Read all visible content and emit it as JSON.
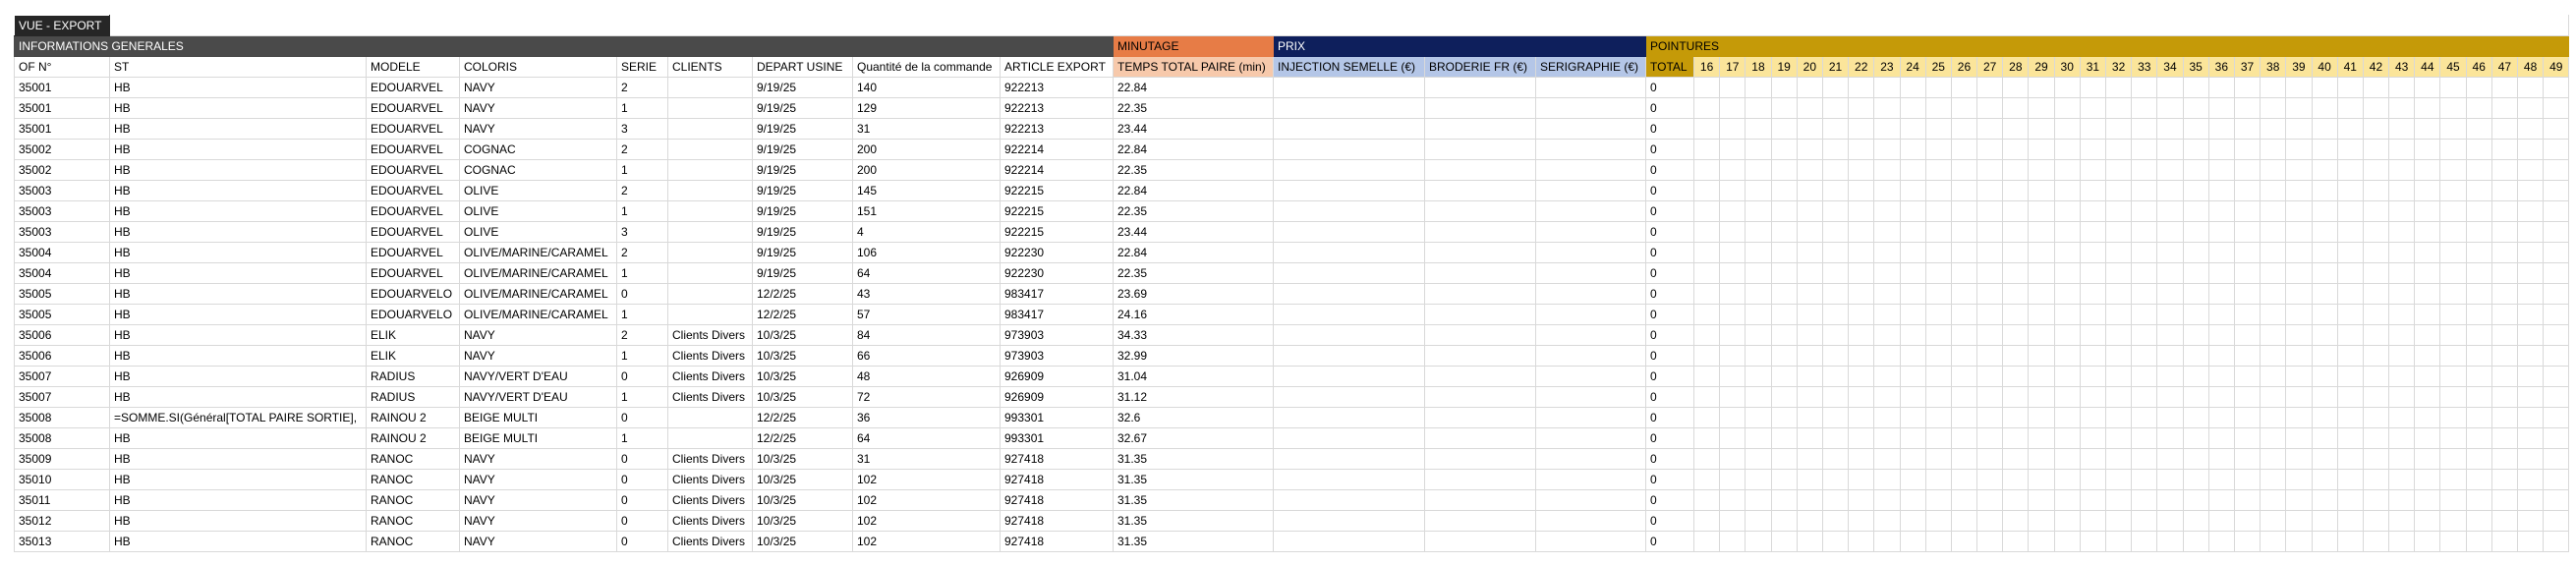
{
  "toolbar": {
    "view_label": "VUE - EXPORT"
  },
  "sections": {
    "info": "INFORMATIONS GENERALES",
    "minutage": "MINUTAGE",
    "prix": "PRIX",
    "pointures": "POINTURES"
  },
  "headers": {
    "of": "OF N°",
    "st": "ST",
    "modele": "MODELE",
    "coloris": "COLORIS",
    "serie": "SERIE",
    "clients": "CLIENTS",
    "depart": "DEPART USINE",
    "quantite": "Quantité de la commande",
    "article": "ARTICLE EXPORT",
    "temps": "TEMPS TOTAL PAIRE (min)",
    "injection": "INJECTION SEMELLE (€)",
    "broderie": "BRODERIE FR (€)",
    "serigraphie": "SERIGRAPHIE (€)",
    "total": "TOTAL"
  },
  "sizes": [
    "16",
    "17",
    "18",
    "19",
    "20",
    "21",
    "22",
    "23",
    "24",
    "25",
    "26",
    "27",
    "28",
    "29",
    "30",
    "31",
    "32",
    "33",
    "34",
    "35",
    "36",
    "37",
    "38",
    "39",
    "40",
    "41",
    "42",
    "43",
    "44",
    "45",
    "46",
    "47",
    "48",
    "49"
  ],
  "rows": [
    {
      "of": "35001",
      "st": "HB",
      "modele": "EDOUARVEL",
      "coloris": "NAVY",
      "serie": "2",
      "clients": "",
      "depart": "9/19/25",
      "quantite": "140",
      "article": "922213",
      "temps": "22.84",
      "total": "0"
    },
    {
      "of": "35001",
      "st": "HB",
      "modele": "EDOUARVEL",
      "coloris": "NAVY",
      "serie": "1",
      "clients": "",
      "depart": "9/19/25",
      "quantite": "129",
      "article": "922213",
      "temps": "22.35",
      "total": "0"
    },
    {
      "of": "35001",
      "st": "HB",
      "modele": "EDOUARVEL",
      "coloris": "NAVY",
      "serie": "3",
      "clients": "",
      "depart": "9/19/25",
      "quantite": "31",
      "article": "922213",
      "temps": "23.44",
      "total": "0"
    },
    {
      "of": "35002",
      "st": "HB",
      "modele": "EDOUARVEL",
      "coloris": "COGNAC",
      "serie": "2",
      "clients": "",
      "depart": "9/19/25",
      "quantite": "200",
      "article": "922214",
      "temps": "22.84",
      "total": "0"
    },
    {
      "of": "35002",
      "st": "HB",
      "modele": "EDOUARVEL",
      "coloris": "COGNAC",
      "serie": "1",
      "clients": "",
      "depart": "9/19/25",
      "quantite": "200",
      "article": "922214",
      "temps": "22.35",
      "total": "0"
    },
    {
      "of": "35003",
      "st": "HB",
      "modele": "EDOUARVEL",
      "coloris": "OLIVE",
      "serie": "2",
      "clients": "",
      "depart": "9/19/25",
      "quantite": "145",
      "article": "922215",
      "temps": "22.84",
      "total": "0"
    },
    {
      "of": "35003",
      "st": "HB",
      "modele": "EDOUARVEL",
      "coloris": "OLIVE",
      "serie": "1",
      "clients": "",
      "depart": "9/19/25",
      "quantite": "151",
      "article": "922215",
      "temps": "22.35",
      "total": "0"
    },
    {
      "of": "35003",
      "st": "HB",
      "modele": "EDOUARVEL",
      "coloris": "OLIVE",
      "serie": "3",
      "clients": "",
      "depart": "9/19/25",
      "quantite": "4",
      "article": "922215",
      "temps": "23.44",
      "total": "0"
    },
    {
      "of": "35004",
      "st": "HB",
      "modele": "EDOUARVEL",
      "coloris": "OLIVE/MARINE/CARAMEL",
      "serie": "2",
      "clients": "",
      "depart": "9/19/25",
      "quantite": "106",
      "article": "922230",
      "temps": "22.84",
      "total": "0"
    },
    {
      "of": "35004",
      "st": "HB",
      "modele": "EDOUARVEL",
      "coloris": "OLIVE/MARINE/CARAMEL",
      "serie": "1",
      "clients": "",
      "depart": "9/19/25",
      "quantite": "64",
      "article": "922230",
      "temps": "22.35",
      "total": "0"
    },
    {
      "of": "35005",
      "st": "HB",
      "modele": "EDOUARVELO",
      "coloris": "OLIVE/MARINE/CARAMEL",
      "serie": "0",
      "clients": "",
      "depart": "12/2/25",
      "quantite": "43",
      "article": "983417",
      "temps": "23.69",
      "total": "0"
    },
    {
      "of": "35005",
      "st": "HB",
      "modele": "EDOUARVELO",
      "coloris": "OLIVE/MARINE/CARAMEL",
      "serie": "1",
      "clients": "",
      "depart": "12/2/25",
      "quantite": "57",
      "article": "983417",
      "temps": "24.16",
      "total": "0"
    },
    {
      "of": "35006",
      "st": "HB",
      "modele": "ELIK",
      "coloris": "NAVY",
      "serie": "2",
      "clients": "Clients Divers",
      "depart": "10/3/25",
      "quantite": "84",
      "article": "973903",
      "temps": "34.33",
      "total": "0"
    },
    {
      "of": "35006",
      "st": "HB",
      "modele": "ELIK",
      "coloris": "NAVY",
      "serie": "1",
      "clients": "Clients Divers",
      "depart": "10/3/25",
      "quantite": "66",
      "article": "973903",
      "temps": "32.99",
      "total": "0"
    },
    {
      "of": "35007",
      "st": "HB",
      "modele": "RADIUS",
      "coloris": "NAVY/VERT D'EAU",
      "serie": "0",
      "clients": "Clients Divers",
      "depart": "10/3/25",
      "quantite": "48",
      "article": "926909",
      "temps": "31.04",
      "total": "0"
    },
    {
      "of": "35007",
      "st": "HB",
      "modele": "RADIUS",
      "coloris": "NAVY/VERT D'EAU",
      "serie": "1",
      "clients": "Clients Divers",
      "depart": "10/3/25",
      "quantite": "72",
      "article": "926909",
      "temps": "31.12",
      "total": "0"
    },
    {
      "of": "35008",
      "st": "=SOMME.SI(Général[TOTAL PAIRE SORTIE],",
      "modele": "RAINOU 2",
      "coloris": "BEIGE MULTI",
      "serie": "0",
      "clients": "",
      "depart": "12/2/25",
      "quantite": "36",
      "article": "993301",
      "temps": "32.6",
      "total": "0"
    },
    {
      "of": "35008",
      "st": "HB",
      "modele": "RAINOU 2",
      "coloris": "BEIGE MULTI",
      "serie": "1",
      "clients": "",
      "depart": "12/2/25",
      "quantite": "64",
      "article": "993301",
      "temps": "32.67",
      "total": "0"
    },
    {
      "of": "35009",
      "st": "HB",
      "modele": "RANOC",
      "coloris": "NAVY",
      "serie": "0",
      "clients": "Clients Divers",
      "depart": "10/3/25",
      "quantite": "31",
      "article": "927418",
      "temps": "31.35",
      "total": "0"
    },
    {
      "of": "35010",
      "st": "HB",
      "modele": "RANOC",
      "coloris": "NAVY",
      "serie": "0",
      "clients": "Clients Divers",
      "depart": "10/3/25",
      "quantite": "102",
      "article": "927418",
      "temps": "31.35",
      "total": "0"
    },
    {
      "of": "35011",
      "st": "HB",
      "modele": "RANOC",
      "coloris": "NAVY",
      "serie": "0",
      "clients": "Clients Divers",
      "depart": "10/3/25",
      "quantite": "102",
      "article": "927418",
      "temps": "31.35",
      "total": "0"
    },
    {
      "of": "35012",
      "st": "HB",
      "modele": "RANOC",
      "coloris": "NAVY",
      "serie": "0",
      "clients": "Clients Divers",
      "depart": "10/3/25",
      "quantite": "102",
      "article": "927418",
      "temps": "31.35",
      "total": "0"
    },
    {
      "of": "35013",
      "st": "HB",
      "modele": "RANOC",
      "coloris": "NAVY",
      "serie": "0",
      "clients": "Clients Divers",
      "depart": "10/3/25",
      "quantite": "102",
      "article": "927418",
      "temps": "31.35",
      "total": "0"
    }
  ],
  "colors": {
    "view_tab": "#262626",
    "info": "#4a4a4a",
    "minutage": "#e77c46",
    "minutage_header": "#f7c9ab",
    "prix": "#0e1f5c",
    "prix_header": "#b4c6e7",
    "pointures": "#c59a08",
    "size_header": "#fbe59a"
  }
}
